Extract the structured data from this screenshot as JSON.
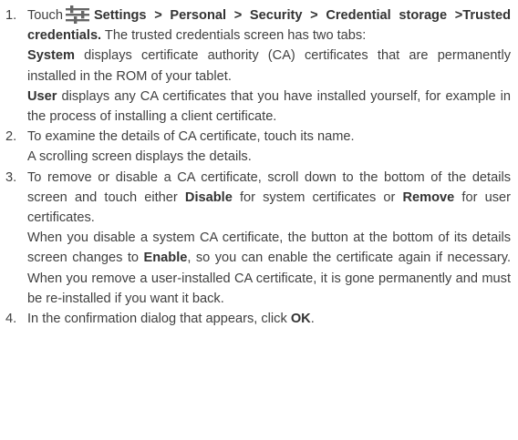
{
  "instructions": {
    "steps": [
      {
        "number": "1.",
        "lead_text": "Touch",
        "settings_icon": "settings-sliders-icon",
        "path_text": "Settings > Personal > Security > Credential storage >Trusted credentials.",
        "after_path_text": "The trusted credentials screen has two tabs:",
        "system_term": "System",
        "system_desc": "displays certificate authority (CA) certificates that are permanently installed in the ROM of your tablet.",
        "user_term": "User",
        "user_desc": "displays any CA certificates that you have installed yourself, for example in the process of installing a client certificate."
      },
      {
        "number": "2.",
        "line1": "To examine the details of CA certificate, touch its name.",
        "line2": "A scrolling screen displays the details."
      },
      {
        "number": "3.",
        "text_a": "To remove or disable a CA certificate, scroll down to the bottom of the details screen and touch either",
        "disable_term": "Disable",
        "text_b": "for system certificates or",
        "remove_term": "Remove",
        "text_c": "for user certificates.",
        "text_d": "When you disable a system CA certificate, the button at the bottom of its details screen changes to",
        "enable_term": "Enable",
        "text_e": ", so you can enable the certificate again if necessary. When you remove a user-installed CA certificate, it is gone permanently and must be re-installed if you want it back."
      },
      {
        "number": "4.",
        "text_a": "In the confirmation dialog that appears, click",
        "ok_term": "OK",
        "text_b": "."
      }
    ]
  }
}
